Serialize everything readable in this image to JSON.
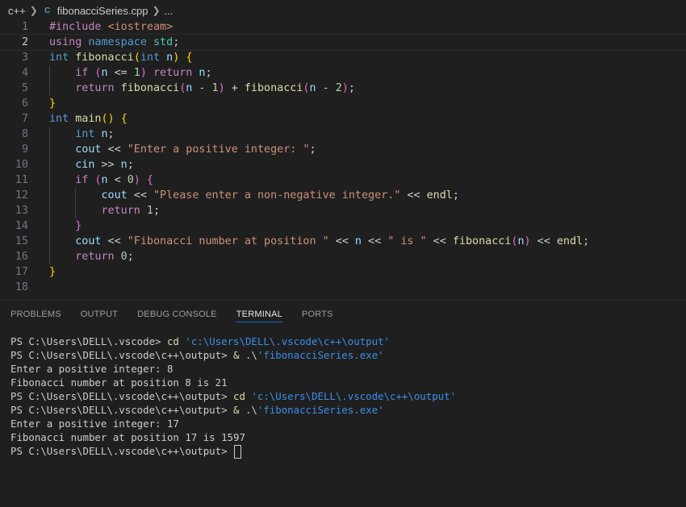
{
  "breadcrumb": {
    "folder": "c++",
    "file_icon": "C",
    "file": "fibonacciSeries.cpp",
    "ellipsis": "..."
  },
  "colors": {
    "keyword": "#569cd6",
    "control": "#c586c0",
    "function": "#dcdcaa",
    "variable": "#9cdcfe",
    "number": "#b5cea8",
    "string": "#ce9178",
    "namespace": "#4ec9b0",
    "terminal_string": "#3b8eea"
  },
  "editor": {
    "current_line": 2,
    "lines": [
      {
        "n": "1",
        "tokens": [
          [
            "pre",
            "#include"
          ],
          [
            "plain",
            " "
          ],
          [
            "str",
            "<iostream>"
          ]
        ]
      },
      {
        "n": "2",
        "tokens": [
          [
            "ctl",
            "using"
          ],
          [
            "plain",
            " "
          ],
          [
            "kw",
            "namespace"
          ],
          [
            "plain",
            " "
          ],
          [
            "ns",
            "std"
          ],
          [
            "plain",
            ";"
          ]
        ]
      },
      {
        "n": "3",
        "tokens": [
          [
            "kw",
            "int"
          ],
          [
            "plain",
            " "
          ],
          [
            "fn",
            "fibonacci"
          ],
          [
            "brk1",
            "("
          ],
          [
            "kw",
            "int"
          ],
          [
            "plain",
            " "
          ],
          [
            "var",
            "n"
          ],
          [
            "brk1",
            ")"
          ],
          [
            "plain",
            " "
          ],
          [
            "brk1",
            "{"
          ]
        ]
      },
      {
        "n": "4",
        "indent": 1,
        "tokens": [
          [
            "ctl",
            "if"
          ],
          [
            "plain",
            " "
          ],
          [
            "brk2",
            "("
          ],
          [
            "var",
            "n"
          ],
          [
            "plain",
            " <= "
          ],
          [
            "num",
            "1"
          ],
          [
            "brk2",
            ")"
          ],
          [
            "plain",
            " "
          ],
          [
            "ctl",
            "return"
          ],
          [
            "plain",
            " "
          ],
          [
            "var",
            "n"
          ],
          [
            "plain",
            ";"
          ]
        ]
      },
      {
        "n": "5",
        "indent": 1,
        "tokens": [
          [
            "ctl",
            "return"
          ],
          [
            "plain",
            " "
          ],
          [
            "fn",
            "fibonacci"
          ],
          [
            "brk2",
            "("
          ],
          [
            "var",
            "n"
          ],
          [
            "plain",
            " - "
          ],
          [
            "num",
            "1"
          ],
          [
            "brk2",
            ")"
          ],
          [
            "plain",
            " + "
          ],
          [
            "fn",
            "fibonacci"
          ],
          [
            "brk2",
            "("
          ],
          [
            "var",
            "n"
          ],
          [
            "plain",
            " - "
          ],
          [
            "num",
            "2"
          ],
          [
            "brk2",
            ")"
          ],
          [
            "plain",
            ";"
          ]
        ]
      },
      {
        "n": "6",
        "tokens": [
          [
            "brk1",
            "}"
          ]
        ]
      },
      {
        "n": "7",
        "tokens": [
          [
            "kw",
            "int"
          ],
          [
            "plain",
            " "
          ],
          [
            "fn",
            "main"
          ],
          [
            "brk1",
            "()"
          ],
          [
            "plain",
            " "
          ],
          [
            "brk1",
            "{"
          ]
        ]
      },
      {
        "n": "8",
        "indent": 1,
        "tokens": [
          [
            "kw",
            "int"
          ],
          [
            "plain",
            " "
          ],
          [
            "var",
            "n"
          ],
          [
            "plain",
            ";"
          ]
        ]
      },
      {
        "n": "9",
        "indent": 1,
        "tokens": [
          [
            "var",
            "cout"
          ],
          [
            "plain",
            " << "
          ],
          [
            "str",
            "\"Enter a positive integer: \""
          ],
          [
            "plain",
            ";"
          ]
        ]
      },
      {
        "n": "10",
        "indent": 1,
        "tokens": [
          [
            "var",
            "cin"
          ],
          [
            "plain",
            " >> "
          ],
          [
            "var",
            "n"
          ],
          [
            "plain",
            ";"
          ]
        ]
      },
      {
        "n": "11",
        "indent": 1,
        "tokens": [
          [
            "ctl",
            "if"
          ],
          [
            "plain",
            " "
          ],
          [
            "brk2",
            "("
          ],
          [
            "var",
            "n"
          ],
          [
            "plain",
            " < "
          ],
          [
            "num",
            "0"
          ],
          [
            "brk2",
            ")"
          ],
          [
            "plain",
            " "
          ],
          [
            "brk2",
            "{"
          ]
        ]
      },
      {
        "n": "12",
        "indent": 2,
        "tokens": [
          [
            "var",
            "cout"
          ],
          [
            "plain",
            " << "
          ],
          [
            "str",
            "\"Please enter a non-negative integer.\""
          ],
          [
            "plain",
            " << "
          ],
          [
            "fn",
            "endl"
          ],
          [
            "plain",
            ";"
          ]
        ]
      },
      {
        "n": "13",
        "indent": 2,
        "tokens": [
          [
            "ctl",
            "return"
          ],
          [
            "plain",
            " "
          ],
          [
            "num",
            "1"
          ],
          [
            "plain",
            ";"
          ]
        ]
      },
      {
        "n": "14",
        "indent": 1,
        "tokens": [
          [
            "brk2",
            "}"
          ]
        ]
      },
      {
        "n": "15",
        "indent": 1,
        "tokens": [
          [
            "var",
            "cout"
          ],
          [
            "plain",
            " << "
          ],
          [
            "str",
            "\"Fibonacci number at position \""
          ],
          [
            "plain",
            " << "
          ],
          [
            "var",
            "n"
          ],
          [
            "plain",
            " << "
          ],
          [
            "str",
            "\" is \""
          ],
          [
            "plain",
            " << "
          ],
          [
            "fn",
            "fibonacci"
          ],
          [
            "brk2",
            "("
          ],
          [
            "var",
            "n"
          ],
          [
            "brk2",
            ")"
          ],
          [
            "plain",
            " << "
          ],
          [
            "fn",
            "endl"
          ],
          [
            "plain",
            ";"
          ]
        ]
      },
      {
        "n": "16",
        "indent": 1,
        "tokens": [
          [
            "ctl",
            "return"
          ],
          [
            "plain",
            " "
          ],
          [
            "num",
            "0"
          ],
          [
            "plain",
            ";"
          ]
        ]
      },
      {
        "n": "17",
        "tokens": [
          [
            "brk1",
            "}"
          ]
        ]
      },
      {
        "n": "18",
        "tokens": []
      }
    ]
  },
  "panel": {
    "tabs": [
      {
        "label": "PROBLEMS"
      },
      {
        "label": "OUTPUT"
      },
      {
        "label": "DEBUG CONSOLE"
      },
      {
        "label": "TERMINAL",
        "active": true
      },
      {
        "label": "PORTS"
      }
    ]
  },
  "terminal": {
    "lines": [
      {
        "prompt": "PS C:\\Users\\DELL\\.vscode> ",
        "cmd": "cd",
        "rest": " ",
        "str": "'c:\\Users\\DELL\\.vscode\\c++\\output'"
      },
      {
        "prompt": "PS C:\\Users\\DELL\\.vscode\\c++\\output> ",
        "cmd": "&",
        "rest": " .\\",
        "str": "'fibonacciSeries.exe'"
      },
      {
        "text": "Enter a positive integer: 8"
      },
      {
        "text": "Fibonacci number at position 8 is 21"
      },
      {
        "prompt": "PS C:\\Users\\DELL\\.vscode\\c++\\output> ",
        "cmd": "cd",
        "rest": " ",
        "str": "'c:\\Users\\DELL\\.vscode\\c++\\output'"
      },
      {
        "prompt": "PS C:\\Users\\DELL\\.vscode\\c++\\output> ",
        "cmd": "&",
        "rest": " .\\",
        "str": "'fibonacciSeries.exe'"
      },
      {
        "text": "Enter a positive integer: 17"
      },
      {
        "text": "Fibonacci number at position 17 is 1597"
      },
      {
        "prompt": "PS C:\\Users\\DELL\\.vscode\\c++\\output> ",
        "cursor": true
      }
    ]
  }
}
